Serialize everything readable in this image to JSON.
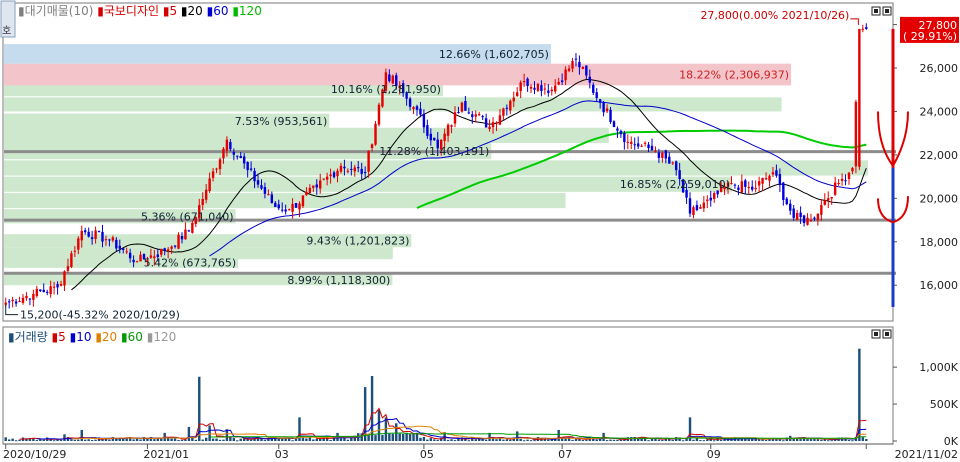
{
  "price_panel": {
    "legend": [
      {
        "label": "대기매물(10)",
        "color": "#7f7f7f"
      },
      {
        "label": "국보디자인",
        "color": "#d40000"
      },
      {
        "label": "5",
        "color": "#d40000"
      },
      {
        "label": "20",
        "color": "#000000"
      },
      {
        "label": "60",
        "color": "#0000cc"
      },
      {
        "label": "120",
        "color": "#00bb00"
      }
    ],
    "side_button": "호"
  },
  "volume_panel": {
    "legend": [
      {
        "label": "거래량",
        "color": "#1c4f7a"
      },
      {
        "label": "5",
        "color": "#d40000"
      },
      {
        "label": "10",
        "color": "#0000cc"
      },
      {
        "label": "20",
        "color": "#e08000"
      },
      {
        "label": "60",
        "color": "#009900"
      },
      {
        "label": "120",
        "color": "#999999"
      }
    ]
  },
  "colors": {
    "up": "#e60000",
    "down": "#0000dd",
    "profile_green": "#cde8cd",
    "profile_blue": "#c5dcee",
    "profile_red": "#f3c4c9",
    "level_line": "#8c8c8c",
    "ma5": "#d40000",
    "ma20": "#000000",
    "ma60": "#0000cc",
    "ma120": "#00cc00",
    "volume_bar": "#1c4f7a"
  },
  "chart_data": [
    {
      "type": "candlestick",
      "name": "국보디자인",
      "y_ticks": [
        "28,000",
        "26,000",
        "24,000",
        "22,000",
        "20,000",
        "18,000",
        "16,000"
      ],
      "y_tick_values": [
        28000,
        26000,
        24000,
        22000,
        20000,
        18000,
        16000
      ],
      "ylim": [
        14400,
        28900
      ],
      "x_ticks": [
        "2020/10/29",
        "2021/01",
        "03",
        "05",
        "07",
        "09",
        "2021/11/02"
      ],
      "x_tick_index": [
        0,
        41,
        79,
        121,
        161,
        204,
        250
      ],
      "n_days": 250,
      "current_price_label": "27,800",
      "current_change_label": "( 29.91%)",
      "max_annotation": "27,800(0.00% 2021/10/26)",
      "min_annotation": "15,200(-45.32% 2020/10/29)",
      "key_points": [
        {
          "i": 0,
          "close": 15200
        },
        {
          "i": 8,
          "close": 15600
        },
        {
          "i": 15,
          "close": 15900
        },
        {
          "i": 22,
          "close": 18500
        },
        {
          "i": 30,
          "close": 18100
        },
        {
          "i": 38,
          "close": 17100
        },
        {
          "i": 46,
          "close": 17600
        },
        {
          "i": 53,
          "close": 18500
        },
        {
          "i": 58,
          "close": 20400
        },
        {
          "i": 64,
          "close": 22700
        },
        {
          "i": 70,
          "close": 21300
        },
        {
          "i": 78,
          "close": 19600
        },
        {
          "i": 82,
          "close": 19500
        },
        {
          "i": 90,
          "close": 20500
        },
        {
          "i": 97,
          "close": 21500
        },
        {
          "i": 104,
          "close": 21200
        },
        {
          "i": 110,
          "close": 25800
        },
        {
          "i": 118,
          "close": 24200
        },
        {
          "i": 125,
          "close": 22300
        },
        {
          "i": 132,
          "close": 24400
        },
        {
          "i": 140,
          "close": 23300
        },
        {
          "i": 150,
          "close": 25400
        },
        {
          "i": 158,
          "close": 25000
        },
        {
          "i": 165,
          "close": 26400
        },
        {
          "i": 172,
          "close": 24400
        },
        {
          "i": 180,
          "close": 22600
        },
        {
          "i": 188,
          "close": 22200
        },
        {
          "i": 194,
          "close": 21300
        },
        {
          "i": 198,
          "close": 19300
        },
        {
          "i": 204,
          "close": 19900
        },
        {
          "i": 210,
          "close": 20700
        },
        {
          "i": 216,
          "close": 20400
        },
        {
          "i": 222,
          "close": 21200
        },
        {
          "i": 228,
          "close": 19100
        },
        {
          "i": 233,
          "close": 19000
        },
        {
          "i": 237,
          "close": 19900
        },
        {
          "i": 242,
          "close": 20900
        },
        {
          "i": 245,
          "close": 21400
        },
        {
          "i": 247,
          "close": 27800
        }
      ],
      "volume_profile": [
        {
          "low": 16000,
          "high": 16500,
          "label": "8.99% (1,118,300)",
          "pct": 8.99
        },
        {
          "low": 16800,
          "high": 17300,
          "label": "5.42% (673,765)",
          "pct": 5.42
        },
        {
          "low": 17200,
          "high": 17750,
          "label": "",
          "pct": 9.0
        },
        {
          "low": 17750,
          "high": 18350,
          "label": "9.43% (1,201,823)",
          "pct": 9.43
        },
        {
          "low": 18850,
          "high": 19500,
          "label": "5.36% (671,040)",
          "pct": 5.36
        },
        {
          "low": 19550,
          "high": 20250,
          "label": "",
          "pct": 13.0
        },
        {
          "low": 20300,
          "high": 21000,
          "label": "16.85% (2,259,010)",
          "pct": 16.85
        },
        {
          "low": 21050,
          "high": 21750,
          "label": "",
          "pct": 20.0
        },
        {
          "low": 21800,
          "high": 22550,
          "label": "11.28% (1,403,191)",
          "pct": 11.28
        },
        {
          "low": 22550,
          "high": 23250,
          "label": "",
          "pct": 14.0
        },
        {
          "low": 23200,
          "high": 23900,
          "label": "7.53% (953,561)",
          "pct": 7.53
        },
        {
          "low": 24000,
          "high": 24650,
          "label": "",
          "pct": 18.0
        },
        {
          "low": 24700,
          "high": 25350,
          "label": "10.16% (1,281,950)",
          "pct": 10.16
        },
        {
          "low": 25200,
          "high": 26200,
          "label": "18.22% (2,306,937)",
          "pct": 18.22,
          "highlight": "red"
        },
        {
          "low": 26200,
          "high": 27100,
          "label": "12.66% (1,602,705)",
          "pct": 12.66,
          "highlight": "blue"
        }
      ],
      "level_lines": [
        22150,
        19000,
        16550
      ],
      "volume": {
        "y_ticks": [
          "1,000K",
          "500K",
          "0K"
        ],
        "y_tick_values": [
          1000000,
          500000,
          0
        ],
        "ylim": [
          0,
          1300000
        ],
        "spikes": [
          {
            "i": 17,
            "value": 90000
          },
          {
            "i": 22,
            "value": 150000
          },
          {
            "i": 46,
            "value": 110000
          },
          {
            "i": 53,
            "value": 190000
          },
          {
            "i": 56,
            "value": 870000
          },
          {
            "i": 59,
            "value": 210000
          },
          {
            "i": 64,
            "value": 160000
          },
          {
            "i": 85,
            "value": 320000
          },
          {
            "i": 96,
            "value": 110000
          },
          {
            "i": 104,
            "value": 730000
          },
          {
            "i": 106,
            "value": 880000
          },
          {
            "i": 108,
            "value": 420000
          },
          {
            "i": 110,
            "value": 320000
          },
          {
            "i": 113,
            "value": 240000
          },
          {
            "i": 127,
            "value": 120000
          },
          {
            "i": 140,
            "value": 110000
          },
          {
            "i": 148,
            "value": 130000
          },
          {
            "i": 160,
            "value": 150000
          },
          {
            "i": 173,
            "value": 110000
          },
          {
            "i": 198,
            "value": 320000
          },
          {
            "i": 227,
            "value": 70000
          },
          {
            "i": 247,
            "value": 1250000
          }
        ]
      }
    }
  ]
}
